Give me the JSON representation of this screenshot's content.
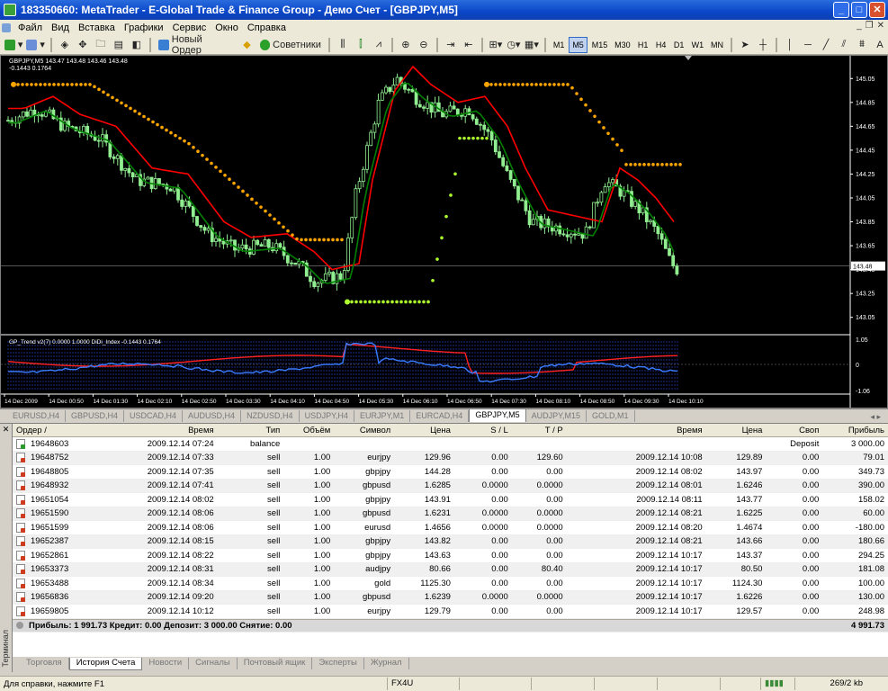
{
  "window": {
    "title": "183350660: MetaTrader - E-Global Trade & Finance Group - Демо Счет - [GBPJPY,M5]"
  },
  "menu": {
    "items": [
      "Файл",
      "Вид",
      "Вставка",
      "Графики",
      "Сервис",
      "Окно",
      "Справка"
    ]
  },
  "toolbar": {
    "new_order": "Новый Ордер",
    "advisors": "Советники",
    "timeframes": [
      "M1",
      "M5",
      "M15",
      "M30",
      "H1",
      "H4",
      "D1",
      "W1",
      "MN"
    ],
    "active_tf": "M5"
  },
  "chart": {
    "header_line1": "GBPJPY,M5  143.47 143.48 143.46 143.48",
    "header_line2": "-0.1443  0.1764",
    "indicator_label": "GP_Trend v2(7) 0.0000 1.0000  DiDi_Index -0.1443 0.1764",
    "price_labels": [
      "145.05",
      "144.85",
      "144.65",
      "144.45",
      "144.25",
      "144.05",
      "143.85",
      "143.65",
      "143.48",
      "143.45",
      "143.25",
      "143.05"
    ],
    "current_price": "143.48",
    "ind_labels": [
      "1.05",
      "0",
      "-1.06"
    ],
    "time_labels": [
      "14 Dec 2009",
      "14 Dec 00:50",
      "14 Dec 01:30",
      "14 Dec 02:10",
      "14 Dec 02:50",
      "14 Dec 03:30",
      "14 Dec 04:10",
      "14 Dec 04:50",
      "14 Dec 05:30",
      "14 Dec 06:10",
      "14 Dec 06:50",
      "14 Dec 07:30",
      "14 Dec 08:10",
      "14 Dec 08:50",
      "14 Dec 09:30",
      "14 Dec 10:10"
    ],
    "colors": {
      "bg": "#000000",
      "candle": "#90ee90",
      "red_line": "#ff0000",
      "green_line": "#008000",
      "orange_dots": "#ffa500",
      "lime_dots": "#adff2f",
      "ind_red": "#ff2020",
      "ind_blue": "#3a7cff",
      "ind_grid": "#1a2a8a"
    }
  },
  "chart_tabs": {
    "items": [
      "EURUSD,H4",
      "GBPUSD,H4",
      "USDCAD,H4",
      "AUDUSD,H4",
      "NZDUSD,H4",
      "USDJPY,H4",
      "EURJPY,M1",
      "EURCAD,H4",
      "GBPJPY,M5",
      "AUDJPY,M15",
      "GOLD,M1"
    ],
    "active": "GBPJPY,M5"
  },
  "terminal": {
    "side_label": "Терминал",
    "headers": [
      "Ордер /",
      "Время",
      "Тип",
      "Объём",
      "Символ",
      "Цена",
      "S / L",
      "T / P",
      "Время",
      "Цена",
      "Своп",
      "Прибыль"
    ],
    "rows": [
      [
        "19648603",
        "2009.12.14 07:24",
        "balance",
        "",
        "",
        "",
        "",
        "",
        "",
        "",
        "Deposit",
        "3 000.00"
      ],
      [
        "19648752",
        "2009.12.14 07:33",
        "sell",
        "1.00",
        "eurjpy",
        "129.96",
        "0.00",
        "129.60",
        "2009.12.14 10:08",
        "129.89",
        "0.00",
        "79.01"
      ],
      [
        "19648805",
        "2009.12.14 07:35",
        "sell",
        "1.00",
        "gbpjpy",
        "144.28",
        "0.00",
        "0.00",
        "2009.12.14 08:02",
        "143.97",
        "0.00",
        "349.73"
      ],
      [
        "19648932",
        "2009.12.14 07:41",
        "sell",
        "1.00",
        "gbpusd",
        "1.6285",
        "0.0000",
        "0.0000",
        "2009.12.14 08:01",
        "1.6246",
        "0.00",
        "390.00"
      ],
      [
        "19651054",
        "2009.12.14 08:02",
        "sell",
        "1.00",
        "gbpjpy",
        "143.91",
        "0.00",
        "0.00",
        "2009.12.14 08:11",
        "143.77",
        "0.00",
        "158.02"
      ],
      [
        "19651590",
        "2009.12.14 08:06",
        "sell",
        "1.00",
        "gbpusd",
        "1.6231",
        "0.0000",
        "0.0000",
        "2009.12.14 08:21",
        "1.6225",
        "0.00",
        "60.00"
      ],
      [
        "19651599",
        "2009.12.14 08:06",
        "sell",
        "1.00",
        "eurusd",
        "1.4656",
        "0.0000",
        "0.0000",
        "2009.12.14 08:20",
        "1.4674",
        "0.00",
        "-180.00"
      ],
      [
        "19652387",
        "2009.12.14 08:15",
        "sell",
        "1.00",
        "gbpjpy",
        "143.82",
        "0.00",
        "0.00",
        "2009.12.14 08:21",
        "143.66",
        "0.00",
        "180.66"
      ],
      [
        "19652861",
        "2009.12.14 08:22",
        "sell",
        "1.00",
        "gbpjpy",
        "143.63",
        "0.00",
        "0.00",
        "2009.12.14 10:17",
        "143.37",
        "0.00",
        "294.25"
      ],
      [
        "19653373",
        "2009.12.14 08:31",
        "sell",
        "1.00",
        "audjpy",
        "80.66",
        "0.00",
        "80.40",
        "2009.12.14 10:17",
        "80.50",
        "0.00",
        "181.08"
      ],
      [
        "19653488",
        "2009.12.14 08:34",
        "sell",
        "1.00",
        "gold",
        "1125.30",
        "0.00",
        "0.00",
        "2009.12.14 10:17",
        "1124.30",
        "0.00",
        "100.00"
      ],
      [
        "19656836",
        "2009.12.14 09:20",
        "sell",
        "1.00",
        "gbpusd",
        "1.6239",
        "0.0000",
        "0.0000",
        "2009.12.14 10:17",
        "1.6226",
        "0.00",
        "130.00"
      ],
      [
        "19659805",
        "2009.12.14 10:12",
        "sell",
        "1.00",
        "eurjpy",
        "129.79",
        "0.00",
        "0.00",
        "2009.12.14 10:17",
        "129.57",
        "0.00",
        "248.98"
      ]
    ],
    "summary": "Прибыль: 1 991.73  Кредит: 0.00  Депозит: 3 000.00  Снятие: 0.00",
    "summary_total": "4 991.73",
    "tabs": [
      "Торговля",
      "История Счета",
      "Новости",
      "Сигналы",
      "Почтовый ящик",
      "Эксперты",
      "Журнал"
    ],
    "active_tab": "История Счета"
  },
  "status": {
    "help": "Для справки, нажмите F1",
    "profile": "FX4U",
    "traffic": "269/2 kb"
  }
}
